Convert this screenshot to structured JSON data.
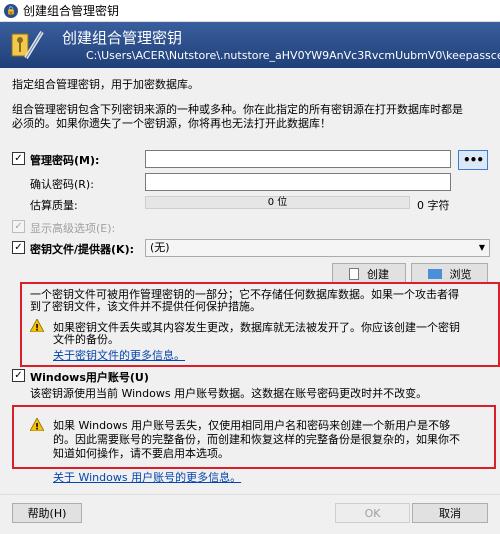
{
  "window": {
    "title": "创建组合管理密钥"
  },
  "banner": {
    "title": "创建组合管理密钥",
    "path": "C:\\Users\\ACER\\Nutstore\\.nutstore_aHV0YW9AnVc3RvcmUubmV0\\keepassceshi\\"
  },
  "intro": {
    "line1": "指定组合管理密钥，用于加密数据库。",
    "line2": "组合管理密钥包含下列密钥来源的一种或多种。你在此指定的所有密钥源在打开数据库时都是",
    "line3": "必须的。如果你遗失了一个密钥源，你将再也无法打开此数据库！"
  },
  "master_password": {
    "label": "管理密码(M):",
    "checked": true,
    "dots_label": "•••",
    "confirm_label": "确认密码(R):",
    "quality_label": "估算质量:",
    "quality_bits": "0 位",
    "char_count": "0 字符"
  },
  "advanced": {
    "label": "显示高级选项(E):",
    "checked": true
  },
  "key_file": {
    "label": "密钥文件/提供器(K):",
    "checked": true,
    "selected": "(无)",
    "create_button": "创建",
    "browse_button": "浏览",
    "desc1": "一个密钥文件可被用作管理密钥的一部分；它不存储任何数据库数据。如果一个攻击者得",
    "desc2": "到了密钥文件，该文件并不提供任何保护措施。",
    "warn1": "如果密钥文件丢失或其内容发生更改，数据库就无法被发开了。你应该创建一个密钥",
    "warn2": "文件的备份。",
    "more_link": "关于密钥文件的更多信息。"
  },
  "windows_account": {
    "label": "Windows用户账号(U)",
    "checked": true,
    "desc": "该密钥源使用当前 Windows 用户账号数据。这数据在账号密码更改时并不改变。",
    "warn1": "如果 Windows 用户账号丢失，仅使用相同用户名和密码来创建一个新用户是不够",
    "warn2": "的。因此需要账号的完整备份，而创建和恢复这样的完整备份是很复杂的，如果你不",
    "warn3": "知道如何操作，请不要启用本选项。",
    "more_link": "关于 Windows 用户账号的更多信息。"
  },
  "footer": {
    "help_button": "帮助(H)",
    "ok_button": "OK",
    "cancel_button": "取消"
  },
  "colors": {
    "banner": "#2a4c8a",
    "highlight": "#d9202a",
    "link": "#0645ad"
  }
}
